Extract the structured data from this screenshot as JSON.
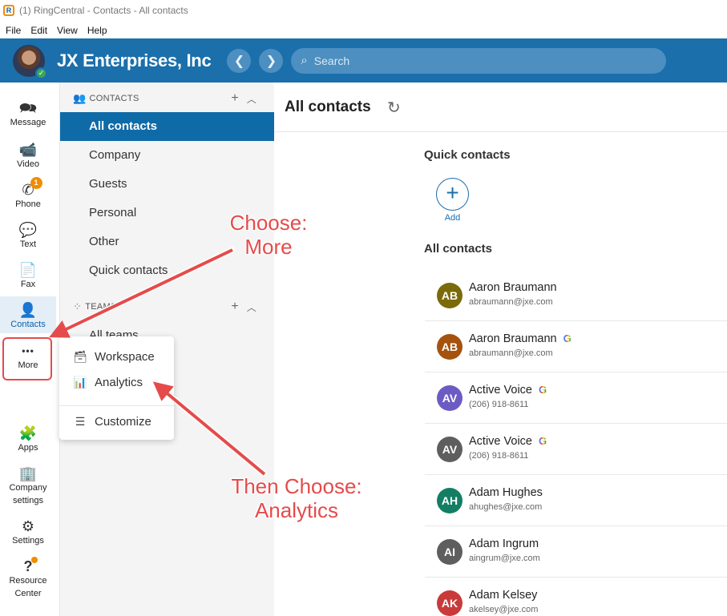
{
  "window": {
    "title": "(1) RingCentral - Contacts - All contacts",
    "logo_letter": "R"
  },
  "menubar": [
    "File",
    "Edit",
    "View",
    "Help"
  ],
  "header": {
    "company": "JX Enterprises, Inc",
    "search_placeholder": "Search",
    "back_glyph": "❮",
    "forward_glyph": "❯",
    "presence_glyph": "✓"
  },
  "rail": {
    "items": [
      {
        "label": "Message",
        "icon": "message-icon",
        "glyph": "🗪"
      },
      {
        "label": "Video",
        "icon": "video-icon",
        "glyph": "📹"
      },
      {
        "label": "Phone",
        "icon": "phone-icon",
        "glyph": "✆",
        "badge": "1"
      },
      {
        "label": "Text",
        "icon": "text-icon",
        "glyph": "💬"
      },
      {
        "label": "Fax",
        "icon": "fax-icon",
        "glyph": "📄"
      },
      {
        "label": "Contacts",
        "icon": "contacts-icon",
        "glyph": "👤"
      },
      {
        "label": "More",
        "icon": "more-icon",
        "glyph": "•••"
      },
      {
        "label": "Apps",
        "icon": "apps-icon",
        "glyph": "🧩"
      },
      {
        "label": "Company",
        "label2": "settings",
        "icon": "company-settings-icon",
        "glyph": "🏢"
      },
      {
        "label": "Settings",
        "icon": "settings-icon",
        "glyph": "⚙"
      },
      {
        "label": "Resource",
        "label2": "Center",
        "icon": "resource-center-icon",
        "glyph": "?"
      }
    ]
  },
  "secnav": {
    "contacts_header": "CONTACTS",
    "contacts_items": [
      "All contacts",
      "Company",
      "Guests",
      "Personal",
      "Other",
      "Quick contacts"
    ],
    "teams_header": "TEAMS",
    "teams_items": [
      "All teams"
    ]
  },
  "popup": {
    "items": [
      {
        "label": "Workspace",
        "icon": "inbox-icon",
        "glyph": "🗃"
      },
      {
        "label": "Analytics",
        "icon": "analytics-icon",
        "glyph": "📊"
      },
      {
        "label": "Customize",
        "icon": "customize-icon",
        "glyph": "☰"
      }
    ]
  },
  "main": {
    "title": "All contacts",
    "quick_contacts_title": "Quick contacts",
    "add_label": "Add",
    "all_contacts_title": "All contacts",
    "contacts": [
      {
        "initials": "AB",
        "name": "Aaron Braumann",
        "sub": "abraumann@jxe.com",
        "color": "#7a6a0a",
        "google": false
      },
      {
        "initials": "AB",
        "name": "Aaron Braumann",
        "sub": "abraumann@jxe.com",
        "color": "#a5520f",
        "google": true
      },
      {
        "initials": "AV",
        "name": "Active Voice",
        "sub": "(206) 918-8611",
        "color": "#6d5bc4",
        "google": true
      },
      {
        "initials": "AV",
        "name": "Active Voice",
        "sub": "(206) 918-8611",
        "color": "#5e5e5e",
        "google": true
      },
      {
        "initials": "AH",
        "name": "Adam Hughes",
        "sub": "ahughes@jxe.com",
        "color": "#137e63",
        "google": false
      },
      {
        "initials": "AI",
        "name": "Adam Ingrum",
        "sub": "aingrum@jxe.com",
        "color": "#5e5e5e",
        "google": false
      },
      {
        "initials": "AK",
        "name": "Adam Kelsey",
        "sub": "akelsey@jxe.com",
        "color": "#c93a3a",
        "google": false
      }
    ],
    "google_glyph": "G"
  },
  "annotations": {
    "choose_more_line1": "Choose:",
    "choose_more_line2": "More",
    "then_line1": "Then Choose:",
    "then_line2": "Analytics",
    "color": "#e54b4b"
  }
}
